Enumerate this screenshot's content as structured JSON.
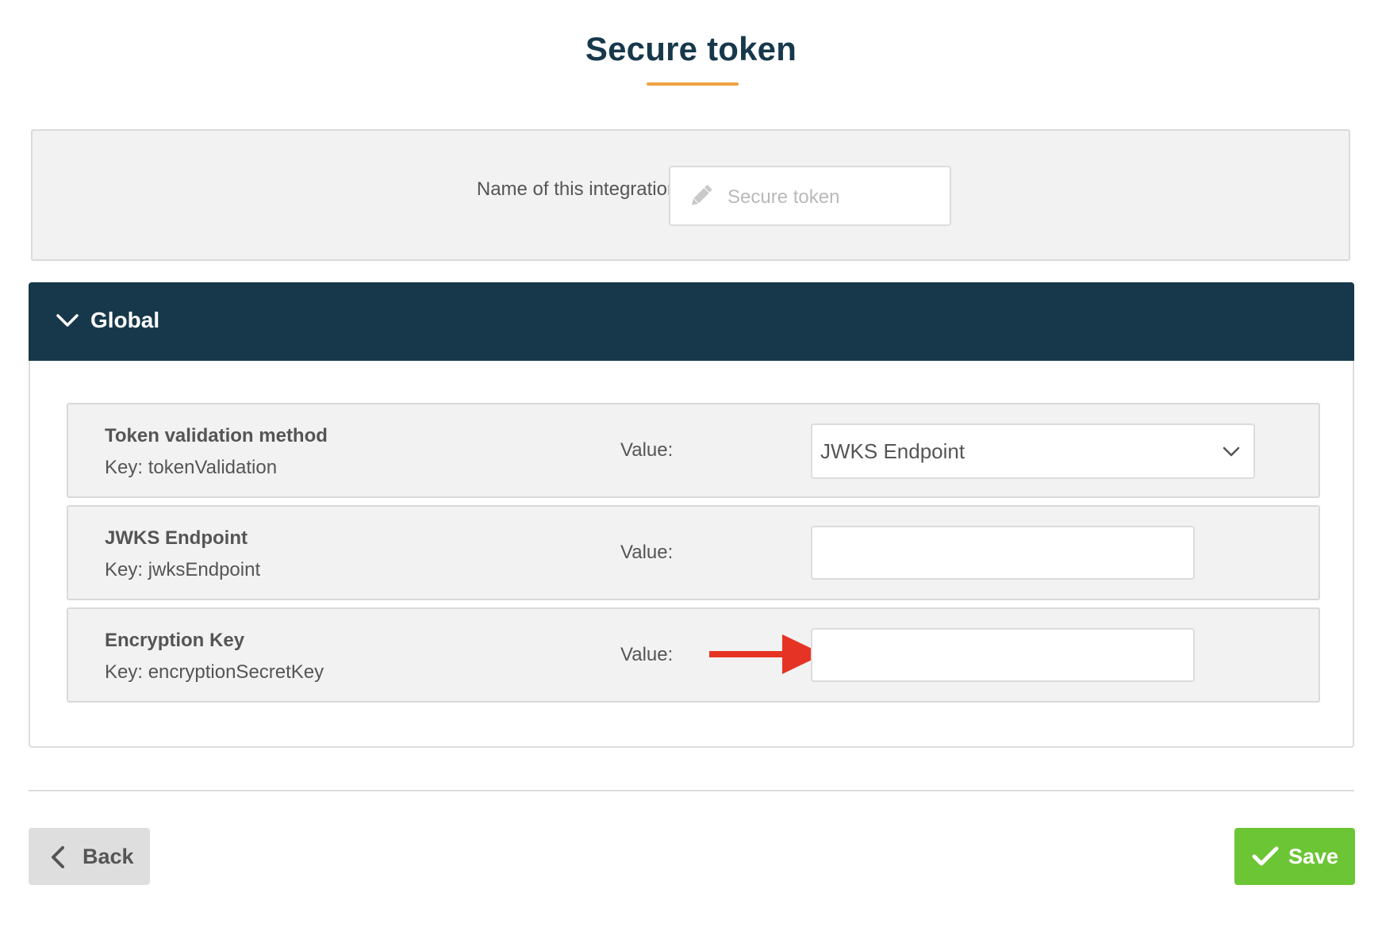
{
  "page": {
    "title": "Secure token"
  },
  "name_panel": {
    "label": "Name of this integration:",
    "input_placeholder": "Secure token",
    "input_value": "",
    "icon": "pencil-icon"
  },
  "section": {
    "title": "Global",
    "icon": "chevron-down-icon",
    "header_color": "#17384b"
  },
  "settings": [
    {
      "name": "Token validation method",
      "key_label": "Key:",
      "key": "tokenValidation",
      "value_label": "Value:",
      "control": "select",
      "value": "JWKS Endpoint"
    },
    {
      "name": "JWKS Endpoint",
      "key_label": "Key:",
      "key": "jwksEndpoint",
      "value_label": "Value:",
      "control": "text",
      "value": ""
    },
    {
      "name": "Encryption Key",
      "key_label": "Key:",
      "key": "encryptionSecretKey",
      "value_label": "Value:",
      "control": "text",
      "value": "",
      "annotation": "red-arrow"
    }
  ],
  "footer": {
    "back_label": "Back",
    "save_label": "Save",
    "save_color": "#6cc534"
  },
  "colors": {
    "title_accent": "#f0a043",
    "annotation_arrow": "#e53425"
  }
}
